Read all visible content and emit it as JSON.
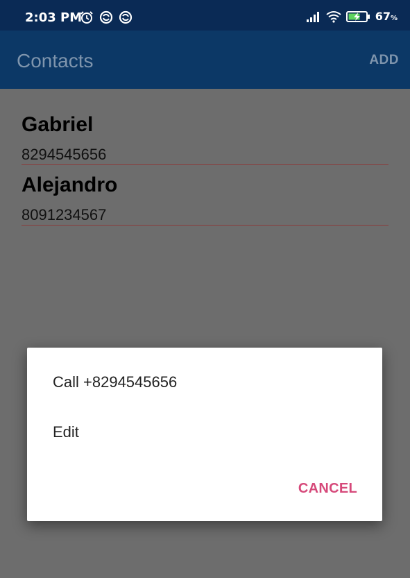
{
  "status_bar": {
    "time": "2:03 PM",
    "battery_percent": "67",
    "battery_unit": "%",
    "icons": [
      "alarm-icon",
      "sync-icon",
      "sync-icon",
      "signal-icon",
      "wifi-icon",
      "battery-charging-icon"
    ]
  },
  "app_bar": {
    "title": "Contacts",
    "add_label": "ADD"
  },
  "contacts": [
    {
      "name": "Gabriel",
      "phone": "8294545656"
    },
    {
      "name": "Alejandro",
      "phone": "8091234567"
    }
  ],
  "dialog": {
    "items": [
      {
        "label": "Call +8294545656"
      },
      {
        "label": "Edit"
      }
    ],
    "cancel_label": "CANCEL"
  },
  "colors": {
    "status_bar": "#0a2a55",
    "app_bar": "#0c3866",
    "overlay": "#6d6d6d",
    "accent": "#d6497a",
    "input_underline": "#8b3a3a"
  }
}
